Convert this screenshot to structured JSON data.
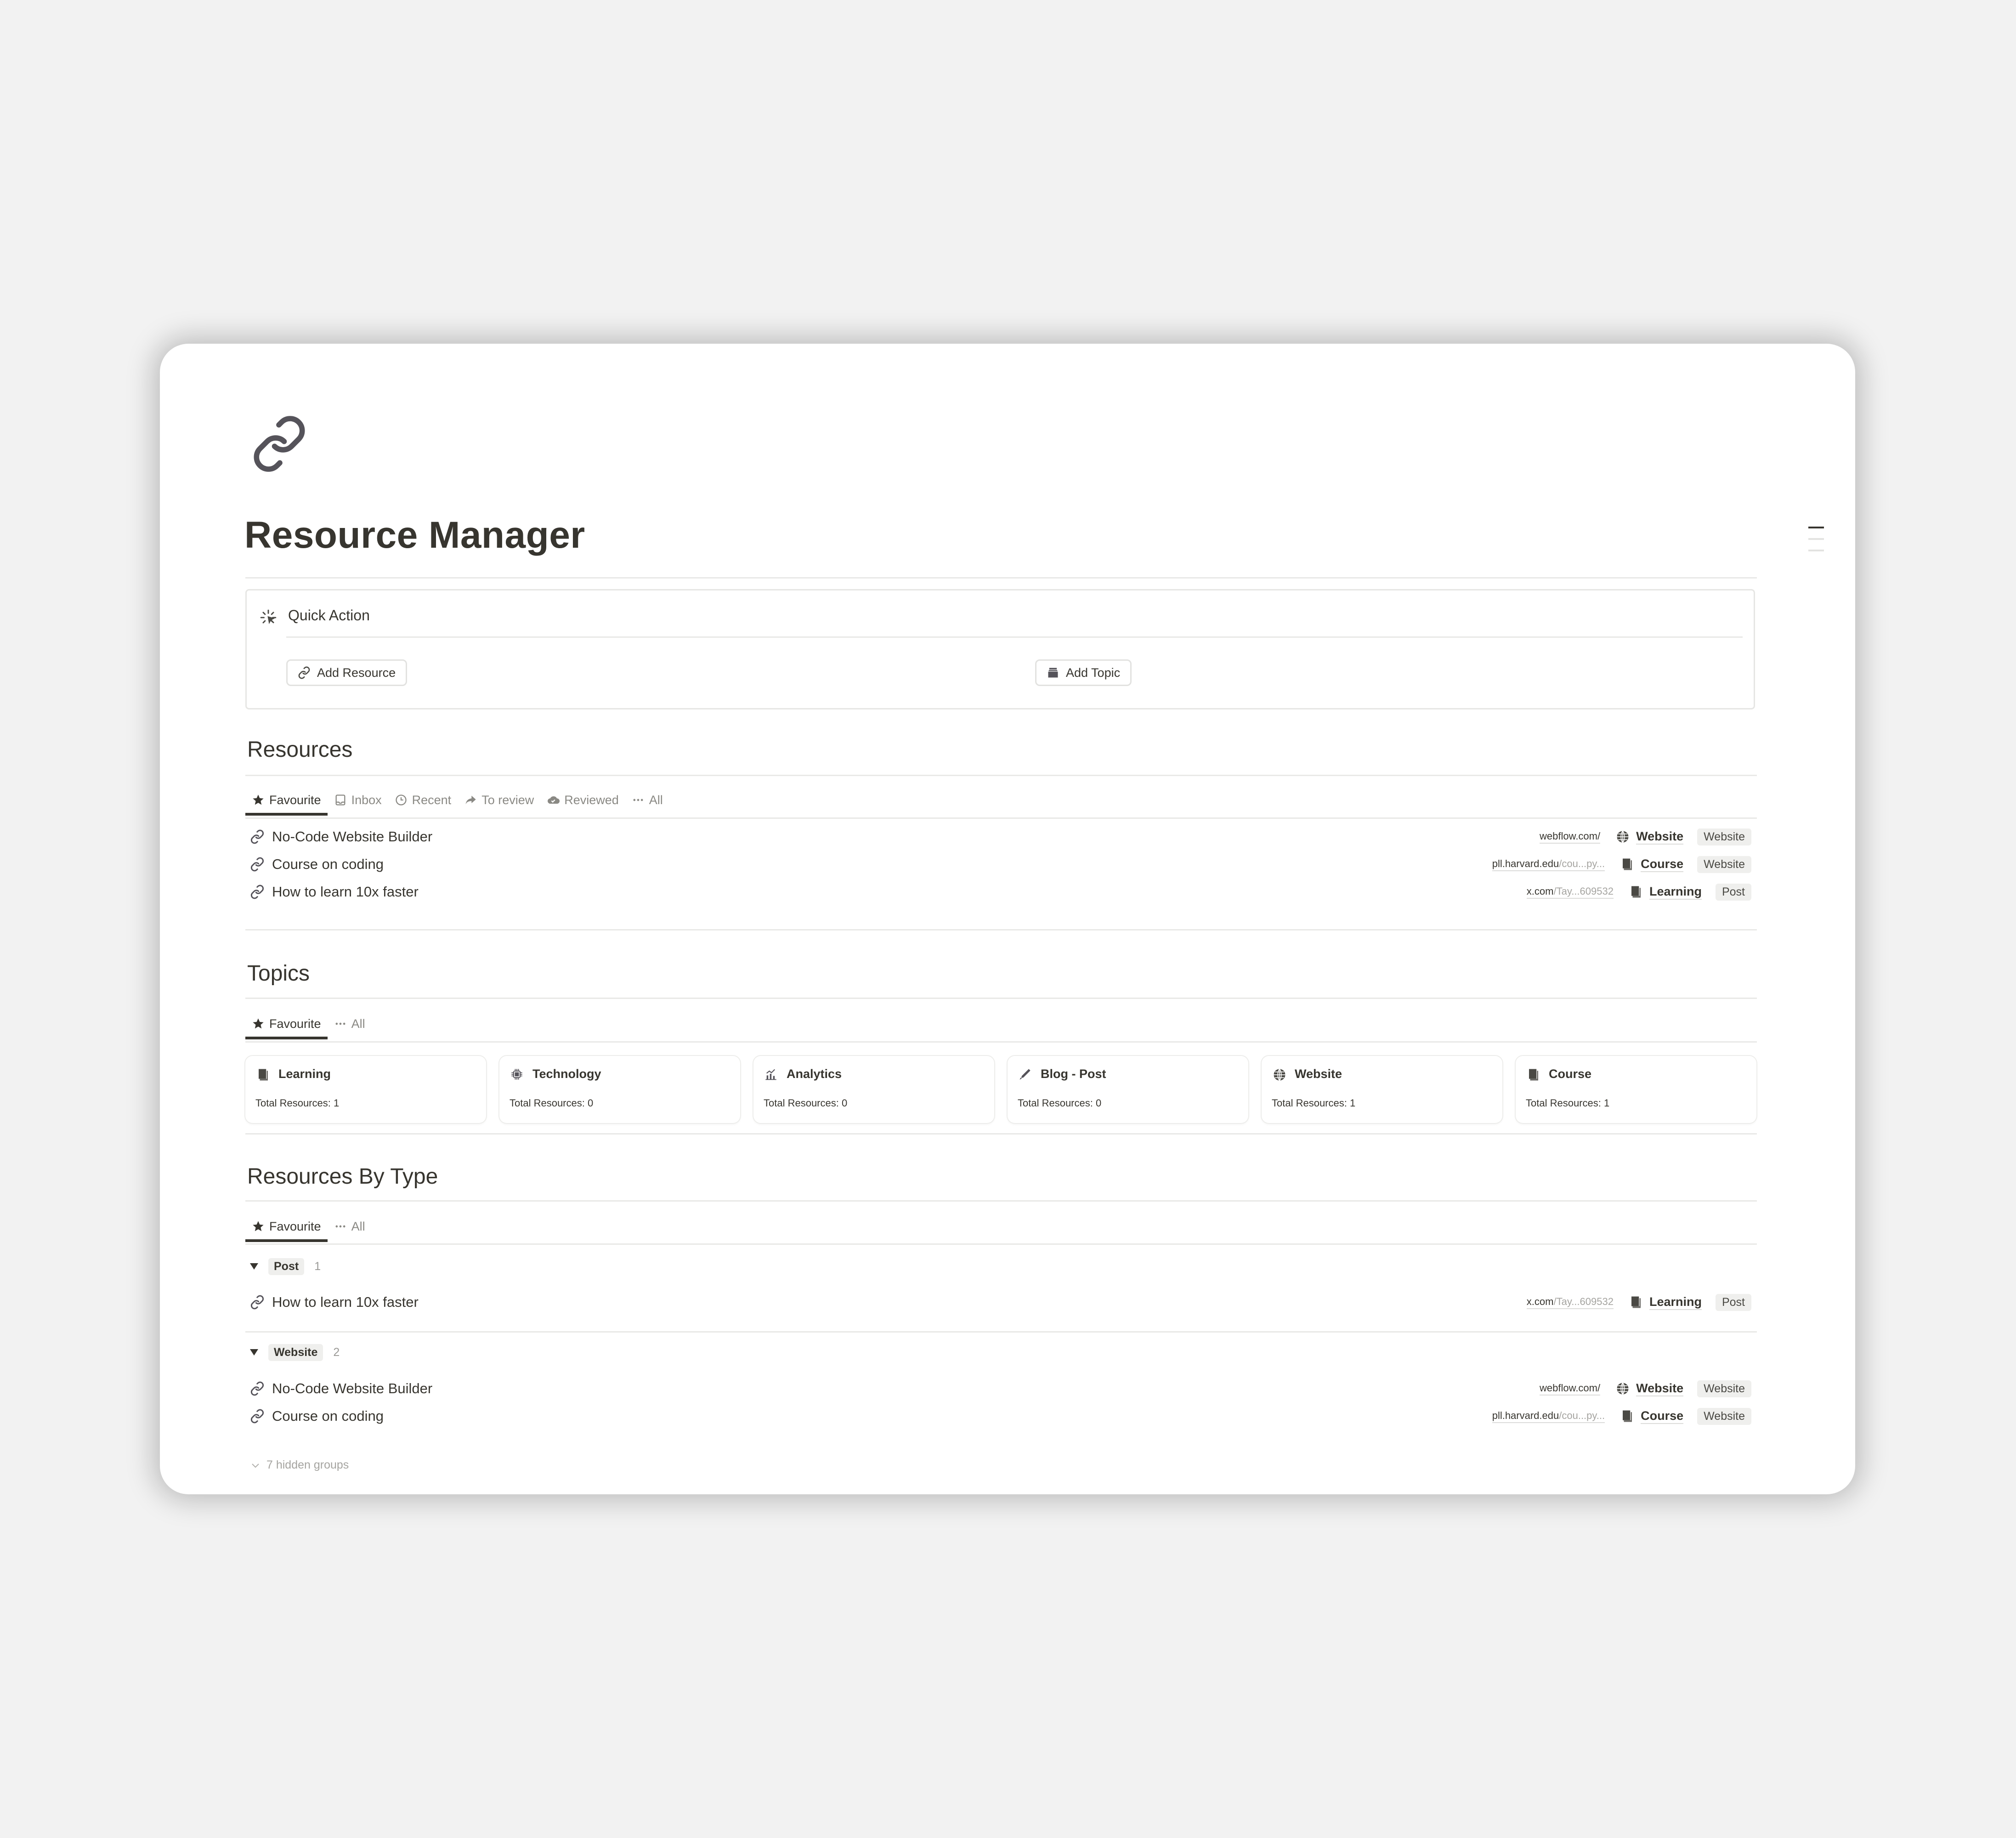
{
  "page": {
    "icon": "link-icon",
    "title": "Resource Manager"
  },
  "quick_action": {
    "icon": "cursor-click-icon",
    "title": "Quick Action",
    "buttons": [
      {
        "label": "Add Resource",
        "icon": "link-icon"
      },
      {
        "label": "Add Topic",
        "icon": "archive-box-icon"
      }
    ]
  },
  "resources": {
    "title": "Resources",
    "tabs": [
      {
        "label": "Favourite",
        "icon": "star-icon",
        "active": true
      },
      {
        "label": "Inbox",
        "icon": "inbox-icon"
      },
      {
        "label": "Recent",
        "icon": "clock-icon"
      },
      {
        "label": "To review",
        "icon": "share-arrow-icon"
      },
      {
        "label": "Reviewed",
        "icon": "cloud-check-icon"
      },
      {
        "label": "All",
        "icon": "ellipsis-icon"
      }
    ],
    "rows": [
      {
        "name": "No-Code Website Builder",
        "url_host": "webflow.com/",
        "url_rest": "",
        "topic": "Website",
        "topic_icon": "globe-icon",
        "type": "Website"
      },
      {
        "name": "Course on coding",
        "url_host": "pll.harvard.edu",
        "url_rest": "/cou...py...",
        "topic": "Course",
        "topic_icon": "book-icon",
        "type": "Website"
      },
      {
        "name": "How to learn 10x faster",
        "url_host": "x.com",
        "url_rest": "/Tay...609532",
        "topic": "Learning",
        "topic_icon": "book-icon",
        "type": "Post"
      }
    ]
  },
  "topics": {
    "title": "Topics",
    "tabs": [
      {
        "label": "Favourite",
        "icon": "star-icon",
        "active": true
      },
      {
        "label": "All",
        "icon": "ellipsis-icon"
      }
    ],
    "cards": [
      {
        "title": "Learning",
        "icon": "book-icon",
        "meta": "Total Resources: 1"
      },
      {
        "title": "Technology",
        "icon": "chip-icon",
        "meta": "Total Resources: 0"
      },
      {
        "title": "Analytics",
        "icon": "chart-icon",
        "meta": "Total Resources: 0"
      },
      {
        "title": "Blog - Post",
        "icon": "pen-icon",
        "meta": "Total Resources: 0"
      },
      {
        "title": "Website",
        "icon": "globe-icon",
        "meta": "Total Resources: 1"
      },
      {
        "title": "Course",
        "icon": "book-icon",
        "meta": "Total Resources: 1"
      }
    ]
  },
  "by_type": {
    "title": "Resources By Type",
    "tabs": [
      {
        "label": "Favourite",
        "icon": "star-icon",
        "active": true
      },
      {
        "label": "All",
        "icon": "ellipsis-icon"
      }
    ],
    "groups": [
      {
        "label": "Post",
        "count": "1",
        "rows": [
          {
            "name": "How to learn 10x faster",
            "url_host": "x.com",
            "url_rest": "/Tay...609532",
            "topic": "Learning",
            "topic_icon": "book-icon",
            "type": "Post"
          }
        ]
      },
      {
        "label": "Website",
        "count": "2",
        "rows": [
          {
            "name": "No-Code Website Builder",
            "url_host": "webflow.com/",
            "url_rest": "",
            "topic": "Website",
            "topic_icon": "globe-icon",
            "type": "Website"
          },
          {
            "name": "Course on coding",
            "url_host": "pll.harvard.edu",
            "url_rest": "/cou...py...",
            "topic": "Course",
            "topic_icon": "book-icon",
            "type": "Website"
          }
        ]
      }
    ],
    "hidden_groups": "7 hidden groups"
  },
  "colors": {
    "text": "#37352f",
    "muted": "#8a8984",
    "background": "#f2f2f2",
    "tag_bg": "#efefed"
  }
}
